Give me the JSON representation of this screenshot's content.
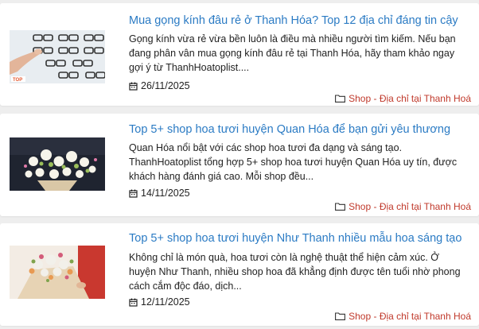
{
  "articles": [
    {
      "title": "Mua gọng kính đâu rẻ ở Thanh Hóa? Top 12 địa chỉ đáng tin cậy",
      "excerpt": "Gọng kính vừa rẻ vừa bền luôn là điều mà nhiều người tìm kiếm. Nếu bạn đang phân vân mua gọng kính đâu rẻ tại Thanh Hóa, hãy tham khảo ngay gợi ý từ ThanhHoatoplist....",
      "date": "26/11/2025",
      "category": "Shop - Địa chỉ tại Thanh Hoá",
      "thumb_badge": "TOP"
    },
    {
      "title": "Top 5+ shop hoa tươi huyện Quan Hóa để bạn gửi yêu thương",
      "excerpt": "Quan Hóa nổi bật với các shop hoa tươi đa dạng và sáng tạo. ThanhHoatoplist tổng hợp 5+ shop hoa tươi huyện Quan Hóa  uy tín, được khách hàng đánh giá cao. Mỗi shop đều...",
      "date": "14/11/2025",
      "category": "Shop - Địa chỉ tại Thanh Hoá"
    },
    {
      "title": "Top 5+ shop hoa tươi huyện Như Thanh nhiều mẫu hoa sáng tạo",
      "excerpt": "Không chỉ là món quà, hoa tươi còn là nghệ thuật thể hiện cảm xúc. Ở huyện Như Thanh, nhiều shop hoa đã khẳng định được tên tuổi nhờ phong cách cắm độc đáo, dịch...",
      "date": "12/11/2025",
      "category": "Shop - Địa chỉ tại Thanh Hoá"
    }
  ],
  "icons": {
    "date": "calendar-icon",
    "category": "folder-icon"
  },
  "colors": {
    "title": "#2b7bc4",
    "category": "#c0392b",
    "card_bg": "#ffffff",
    "page_bg": "#eeeeee"
  }
}
